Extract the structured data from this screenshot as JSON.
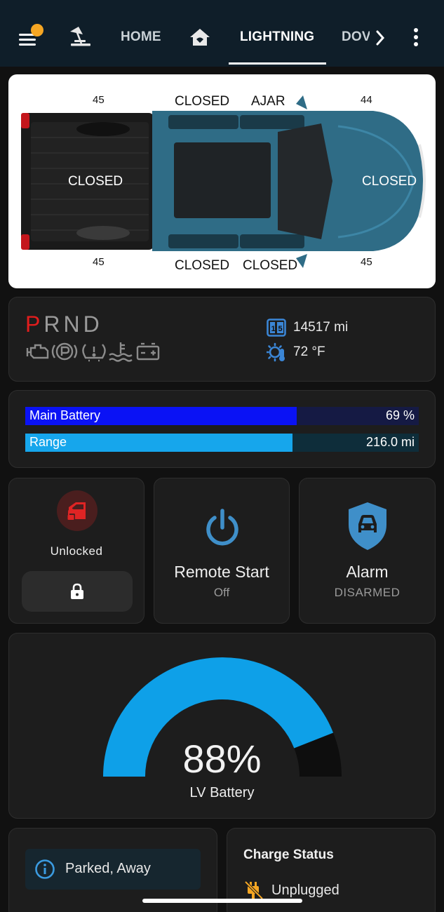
{
  "nav": {
    "tabs": [
      {
        "label": "HOME"
      },
      {
        "label": "LIGHTNING"
      },
      {
        "label": "DOV"
      }
    ],
    "colors": {
      "bar": "#0f1e29",
      "notification": "#f5a623"
    }
  },
  "truck": {
    "tire_pressures": {
      "rear_left": "45",
      "front_left": "44",
      "rear_right": "45",
      "front_right": "45"
    },
    "doors": {
      "rear_left_door": "CLOSED",
      "front_left_door": "AJAR",
      "rear_right_door": "CLOSED",
      "front_right_door": "CLOSED"
    },
    "tailgate": "CLOSED",
    "frunk": "CLOSED",
    "body_color": "#2f6c86"
  },
  "vehicle_status": {
    "gear": {
      "p": "P",
      "rest": "RND"
    },
    "odometer": "14517 mi",
    "outside_temp": "72 °F"
  },
  "battery": {
    "main": {
      "label": "Main Battery",
      "value": "69 %",
      "percent": 69,
      "color": "#0a12f5",
      "track": "#151a44"
    },
    "range": {
      "label": "Range",
      "value": "216.0 mi",
      "percent": 68,
      "color": "#16a6ec",
      "track": "#0e2d3a"
    }
  },
  "lock": {
    "status": "Unlocked",
    "accent": "#e02424"
  },
  "remote_start": {
    "title": "Remote Start",
    "state": "Off",
    "accent": "#3f8fc9"
  },
  "alarm": {
    "title": "Alarm",
    "state": "DISARMED",
    "accent": "#3f8fc9"
  },
  "lv_battery": {
    "value": "88%",
    "percent": 88,
    "label": "LV Battery",
    "color": "#0ea0e8",
    "track": "#0e0e0e"
  },
  "parked": {
    "text": "Parked, Away"
  },
  "charge": {
    "title": "Charge Status",
    "state": "Unplugged",
    "accent": "#f5a623"
  }
}
